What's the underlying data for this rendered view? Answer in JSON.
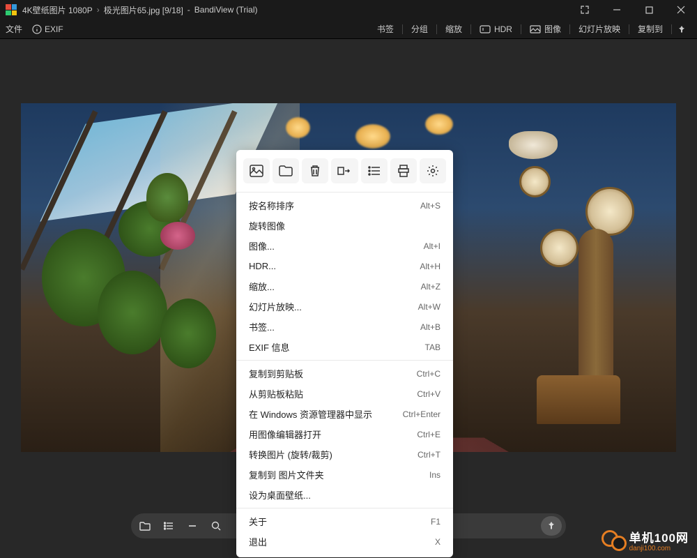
{
  "title": {
    "folder": "4K壁纸图片 1080P",
    "file": "极光图片65.jpg [9/18]",
    "app": "BandiView (Trial)"
  },
  "menubar": {
    "file": "文件",
    "exif": "EXIF"
  },
  "toolbar_right": {
    "bookmark": "书签",
    "group": "分组",
    "zoom": "缩放",
    "hdr": "HDR",
    "image": "图像",
    "slideshow": "幻灯片放映",
    "copyto": "复制到"
  },
  "context_menu": {
    "items_a": [
      {
        "label": "按名称排序",
        "shortcut": "Alt+S"
      },
      {
        "label": "旋转图像",
        "shortcut": ""
      },
      {
        "label": "图像...",
        "shortcut": "Alt+I"
      },
      {
        "label": "HDR...",
        "shortcut": "Alt+H"
      },
      {
        "label": "缩放...",
        "shortcut": "Alt+Z"
      },
      {
        "label": "幻灯片放映...",
        "shortcut": "Alt+W"
      },
      {
        "label": "书签...",
        "shortcut": "Alt+B"
      },
      {
        "label": "EXIF 信息",
        "shortcut": "TAB"
      }
    ],
    "items_b": [
      {
        "label": "复制到剪贴板",
        "shortcut": "Ctrl+C"
      },
      {
        "label": "从剪贴板粘贴",
        "shortcut": "Ctrl+V"
      },
      {
        "label": "在 Windows 资源管理器中显示",
        "shortcut": "Ctrl+Enter"
      },
      {
        "label": "用图像编辑器打开",
        "shortcut": "Ctrl+E"
      },
      {
        "label": "转换图片 (旋转/裁剪)",
        "shortcut": "Ctrl+T"
      },
      {
        "label": "复制到 图片文件夹",
        "shortcut": "Ins"
      },
      {
        "label": "设为桌面壁纸...",
        "shortcut": ""
      }
    ],
    "items_c": [
      {
        "label": "关于",
        "shortcut": "F1"
      },
      {
        "label": "退出",
        "shortcut": "X"
      }
    ]
  },
  "watermark": {
    "cn": "单机100网",
    "en": "danji100.com"
  }
}
